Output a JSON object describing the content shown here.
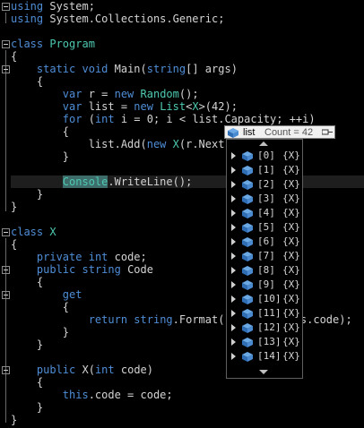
{
  "editor": {
    "line1": [
      "using",
      " System;"
    ],
    "line2": [
      "using",
      " System.Collections.Generic;"
    ],
    "line4": [
      "class",
      " ",
      "Program"
    ],
    "line5": "{",
    "line6": [
      "    ",
      "static",
      " ",
      "void",
      " Main(",
      "string",
      "[] args)"
    ],
    "line7": "    {",
    "line8": [
      "        ",
      "var",
      " r = ",
      "new",
      " ",
      "Random",
      "();"
    ],
    "line9": [
      "        ",
      "var",
      " list = ",
      "new",
      " ",
      "List",
      "<",
      "X",
      ">(42);"
    ],
    "line10": [
      "        ",
      "for",
      " (",
      "int",
      " i = 0; i < list.Capacity; ++i)"
    ],
    "line11": "        {",
    "line12": [
      "            list.Add(",
      "new",
      " ",
      "X",
      "(r.Next("
    ],
    "line13": "        }",
    "line15": [
      "        ",
      "Console",
      ".",
      "WriteLine();"
    ],
    "line16": "    }",
    "line17": "}",
    "line19": [
      "class",
      " ",
      "X"
    ],
    "line20": "{",
    "line21": [
      "    ",
      "private",
      " ",
      "int",
      " code;"
    ],
    "line22": [
      "    ",
      "public",
      " ",
      "string",
      " Code"
    ],
    "line23": "    {",
    "line24": [
      "        ",
      "get"
    ],
    "line25": "        {",
    "line26": [
      "            ",
      "return",
      " ",
      "string",
      ".Format(\"",
      "",
      "",
      "is.code);"
    ],
    "line27": "        }",
    "line28": "    }",
    "line30": [
      "    ",
      "public",
      " X(",
      "int",
      " code)"
    ],
    "line31": "    {",
    "line32": [
      "        ",
      "this",
      ".code = code;"
    ],
    "line33": "    }",
    "line34": "}"
  },
  "datatip": {
    "name": "list",
    "value": "Count = 42",
    "items": [
      {
        "index": "[0]",
        "value": "{X}"
      },
      {
        "index": "[1]",
        "value": "{X}"
      },
      {
        "index": "[2]",
        "value": "{X}"
      },
      {
        "index": "[3]",
        "value": "{X}"
      },
      {
        "index": "[4]",
        "value": "{X}"
      },
      {
        "index": "[5]",
        "value": "{X}"
      },
      {
        "index": "[6]",
        "value": "{X}"
      },
      {
        "index": "[7]",
        "value": "{X}"
      },
      {
        "index": "[8]",
        "value": "{X}"
      },
      {
        "index": "[9]",
        "value": "{X}"
      },
      {
        "index": "[10]",
        "value": "{X}"
      },
      {
        "index": "[11]",
        "value": "{X}"
      },
      {
        "index": "[12]",
        "value": "{X}"
      },
      {
        "index": "[13]",
        "value": "{X}"
      },
      {
        "index": "[14]",
        "value": "{X}"
      }
    ]
  },
  "colors": {
    "keyword": "#4f8dd6",
    "type": "#4ec9b0",
    "string": "#d69d85",
    "text": "#d4d4d4",
    "background": "#000000"
  }
}
